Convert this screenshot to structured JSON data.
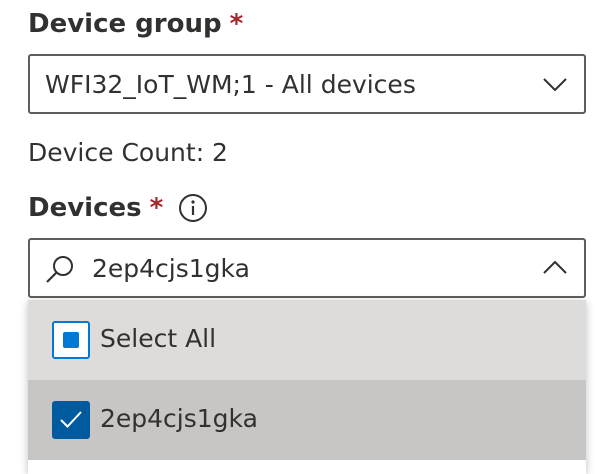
{
  "device_group": {
    "label": "Device group",
    "required_mark": "*",
    "selected_value": "WFI32_IoT_WM;1 - All devices"
  },
  "device_count": {
    "text": "Device Count: 2"
  },
  "devices": {
    "label": "Devices",
    "required_mark": "*",
    "search_value": "2ep4cjs1gka",
    "options": [
      {
        "label": "Select All",
        "state": "indeterminate"
      },
      {
        "label": "2ep4cjs1gka",
        "state": "checked"
      }
    ]
  },
  "icons": {
    "info": "info-icon",
    "search": "search-icon",
    "group_chevron": "chevron-down-icon",
    "devices_chevron": "chevron-up-icon",
    "checkmark": "checkmark-icon"
  },
  "colors": {
    "required": "#a4262c",
    "accent": "#0078d4",
    "checked_fill": "#005a9e",
    "option_hover": "#dedcdb",
    "option_selected": "#c8c6c4"
  }
}
